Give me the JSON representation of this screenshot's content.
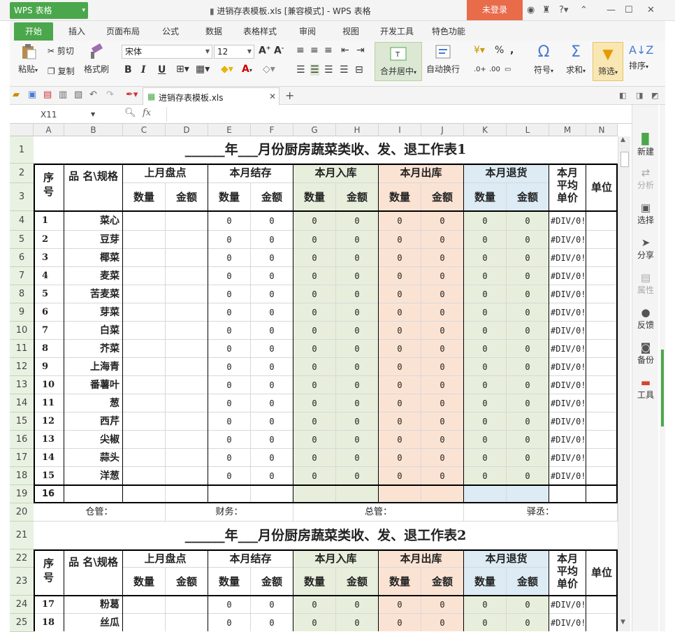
{
  "window": {
    "app_label": "WPS 表格",
    "title": "进销存表模板.xls [兼容模式] - WPS 表格",
    "login": "未登录"
  },
  "tabs": [
    "开始",
    "插入",
    "页面布局",
    "公式",
    "数据",
    "表格样式",
    "审阅",
    "视图",
    "开发工具",
    "特色功能"
  ],
  "ribbon": {
    "paste": "粘贴",
    "cut": "剪切",
    "copy": "复制",
    "format_painter": "格式刷",
    "font": "宋体",
    "size": "12",
    "merge": "合并居中",
    "wrap": "自动换行",
    "symbol": "符号",
    "sum": "求和",
    "filter": "筛选",
    "sort": "排序",
    "bold": "B",
    "italic": "I",
    "underline": "U",
    "pct": "%"
  },
  "doc_tab": "进销存表模板.xls",
  "name_box": "X11",
  "fx": "fx",
  "columns": [
    "A",
    "B",
    "C",
    "D",
    "E",
    "F",
    "G",
    "H",
    "I",
    "J",
    "K",
    "L",
    "M",
    "N"
  ],
  "rows": [
    "1",
    "2",
    "3",
    "4",
    "5",
    "6",
    "7",
    "8",
    "9",
    "10",
    "11",
    "12",
    "13",
    "14",
    "15",
    "16",
    "17",
    "18",
    "19",
    "20",
    "21",
    "22",
    "23",
    "24",
    "25"
  ],
  "sheet": {
    "title1": "______年___月份厨房蔬菜类收、发、退工作表1",
    "title2": "______年___月份厨房蔬菜类收、发、退工作表2",
    "h_seq": "序号",
    "h_name": "品 名\\规格",
    "h_last": "上月盘点",
    "h_stock": "本月结存",
    "h_in": "本月入库",
    "h_out": "本月出库",
    "h_ret": "本月退货",
    "h_avg": "本月平均单价",
    "h_unit": "单位",
    "h_qty": "数量",
    "h_amt": "金额",
    "items1": [
      [
        "1",
        "菜心"
      ],
      [
        "2",
        "豆芽"
      ],
      [
        "3",
        "椰菜"
      ],
      [
        "4",
        "麦菜"
      ],
      [
        "5",
        "苦麦菜"
      ],
      [
        "6",
        "芽菜"
      ],
      [
        "7",
        "白菜"
      ],
      [
        "8",
        "芥菜"
      ],
      [
        "9",
        "上海青"
      ],
      [
        "10",
        "番薯叶"
      ],
      [
        "11",
        "葱"
      ],
      [
        "12",
        "西芹"
      ],
      [
        "13",
        "尖椒"
      ],
      [
        "14",
        "蒜头"
      ],
      [
        "15",
        "洋葱"
      ]
    ],
    "row16": "16",
    "zero": "0",
    "div": "#DIV/0!",
    "footer": {
      "warehouse": "仓管：",
      "finance": "财务：",
      "manager": "总管：",
      "supervisor": "驿丞："
    },
    "items2": [
      [
        "17",
        "粉葛"
      ],
      [
        "18",
        "丝瓜"
      ]
    ]
  },
  "right_panel": [
    "新建",
    "分析",
    "选择",
    "分享",
    "属性",
    "反馈",
    "备份",
    "工具"
  ]
}
